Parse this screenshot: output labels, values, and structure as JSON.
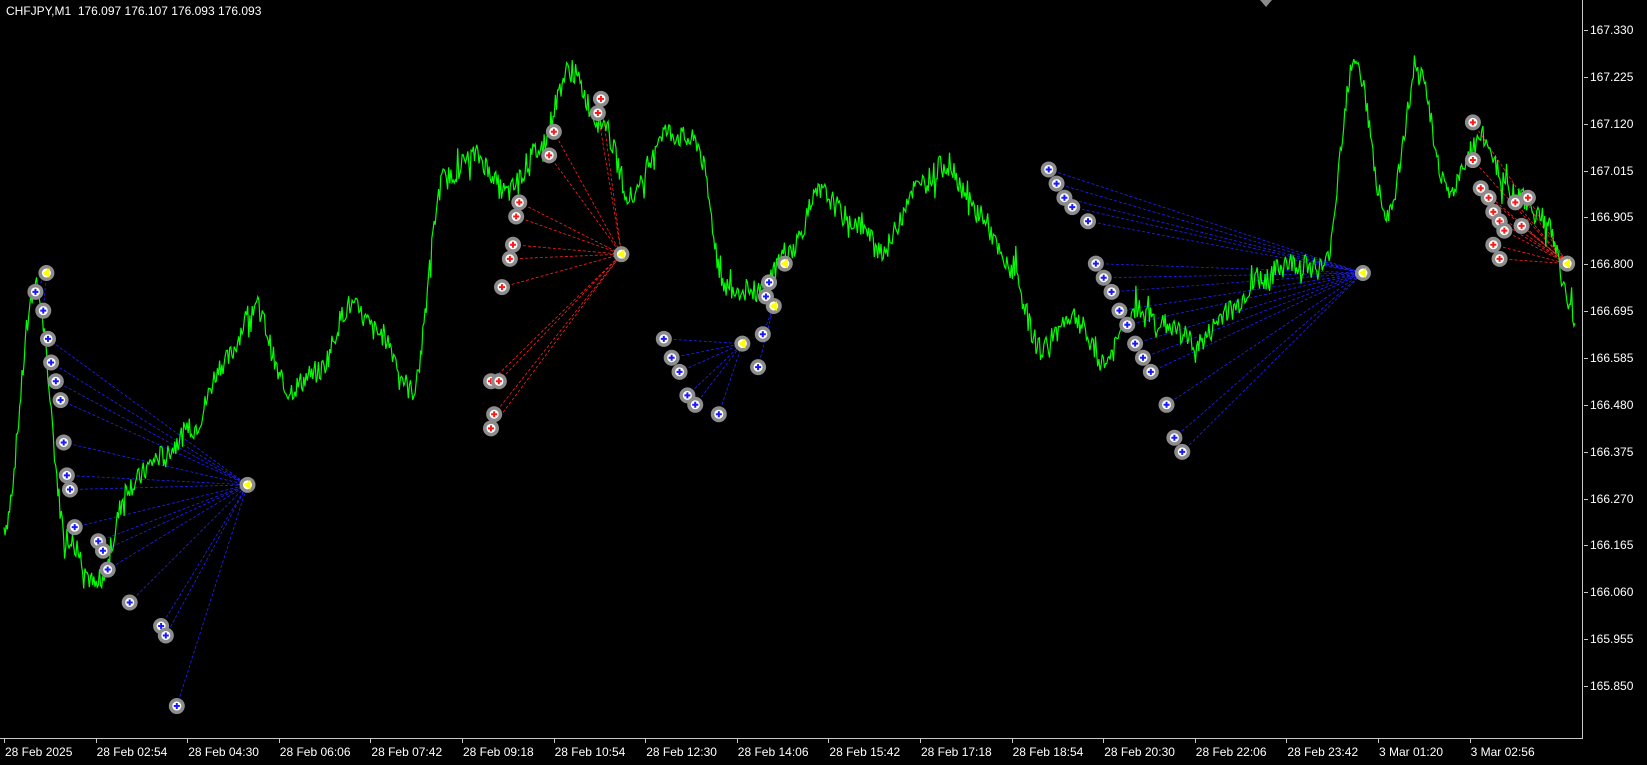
{
  "symbol": "CHFJPY,M1",
  "quote": {
    "open": "176.097",
    "high": "176.107",
    "low": "176.093",
    "close": "176.093"
  },
  "colors": {
    "background": "#000000",
    "price_line": "#00ff00",
    "buy_links": "#2020ff",
    "sell_links": "#ff2020",
    "marker_ring": "#8c8c8c",
    "marker_fill": "#ffffff",
    "close_marker": "#ffff00",
    "axis_text": "#ffffff"
  },
  "icons": {
    "buy_marker": "blue-plus-circle-icon",
    "sell_marker": "red-plus-circle-icon",
    "close_marker": "yellow-arrow-left-icon",
    "shift_marker": "triangle-down-icon"
  },
  "price_axis": {
    "labels": [
      "167.330",
      "167.225",
      "167.120",
      "167.015",
      "166.905",
      "166.800",
      "166.695",
      "166.585",
      "166.480",
      "166.375",
      "166.270",
      "166.165",
      "166.060",
      "165.955",
      "165.850"
    ]
  },
  "time_axis": {
    "labels": [
      "28 Feb 2025",
      "28 Feb 02:54",
      "28 Feb 04:30",
      "28 Feb 06:06",
      "28 Feb 07:42",
      "28 Feb 09:18",
      "28 Feb 10:54",
      "28 Feb 12:30",
      "28 Feb 14:06",
      "28 Feb 15:42",
      "28 Feb 17:18",
      "28 Feb 18:54",
      "28 Feb 20:30",
      "28 Feb 22:06",
      "28 Feb 23:42",
      "3 Mar 01:20",
      "3 Mar 02:56"
    ]
  },
  "chart_data": {
    "type": "line",
    "ylim": [
      165.82,
      167.39
    ],
    "x": [
      "28 Feb 2025",
      "28 Feb 02:54",
      "28 Feb 04:30",
      "28 Feb 06:06",
      "28 Feb 07:42",
      "28 Feb 09:18",
      "28 Feb 10:54",
      "28 Feb 12:30",
      "28 Feb 14:06",
      "28 Feb 15:42",
      "28 Feb 17:18",
      "28 Feb 18:54",
      "28 Feb 20:30",
      "28 Feb 22:06",
      "28 Feb 23:42",
      "3 Mar 01:20",
      "3 Mar 02:56"
    ],
    "series": [
      {
        "values": [
          166.27,
          166.78,
          166.25,
          166.14,
          166.36,
          166.42,
          166.48,
          166.62,
          166.74,
          166.56,
          166.6,
          166.74,
          166.68,
          166.56,
          167.01,
          167.06,
          166.98,
          167.07,
          167.24,
          167.13,
          166.97,
          167.11,
          167.09,
          166.78,
          166.77,
          166.86,
          166.98,
          166.92,
          166.86,
          166.99,
          167.04,
          166.94,
          166.82,
          166.65,
          166.72,
          166.62,
          166.73,
          166.7,
          166.66,
          166.73,
          166.8,
          166.83,
          166.82,
          167.27,
          166.92,
          167.23,
          166.98,
          167.1,
          166.98,
          166.93,
          166.72
        ]
      }
    ],
    "trades": {
      "buy_entries": [
        {
          "t": 0.02,
          "p": 166.77
        },
        {
          "t": 0.025,
          "p": 166.73
        },
        {
          "t": 0.028,
          "p": 166.67
        },
        {
          "t": 0.03,
          "p": 166.62
        },
        {
          "t": 0.033,
          "p": 166.58
        },
        {
          "t": 0.036,
          "p": 166.54
        },
        {
          "t": 0.038,
          "p": 166.45
        },
        {
          "t": 0.04,
          "p": 166.38
        },
        {
          "t": 0.042,
          "p": 166.35
        },
        {
          "t": 0.045,
          "p": 166.27
        },
        {
          "t": 0.06,
          "p": 166.24
        },
        {
          "t": 0.063,
          "p": 166.22
        },
        {
          "t": 0.066,
          "p": 166.18
        },
        {
          "t": 0.08,
          "p": 166.11
        },
        {
          "t": 0.1,
          "p": 166.06
        },
        {
          "t": 0.103,
          "p": 166.04
        },
        {
          "t": 0.11,
          "p": 165.89
        },
        {
          "t": 0.42,
          "p": 166.67
        },
        {
          "t": 0.425,
          "p": 166.63
        },
        {
          "t": 0.43,
          "p": 166.6
        },
        {
          "t": 0.435,
          "p": 166.55
        },
        {
          "t": 0.44,
          "p": 166.53
        },
        {
          "t": 0.455,
          "p": 166.51
        },
        {
          "t": 0.48,
          "p": 166.61
        },
        {
          "t": 0.483,
          "p": 166.68
        },
        {
          "t": 0.485,
          "p": 166.76
        },
        {
          "t": 0.487,
          "p": 166.79
        },
        {
          "t": 0.665,
          "p": 167.03
        },
        {
          "t": 0.67,
          "p": 167.0
        },
        {
          "t": 0.675,
          "p": 166.97
        },
        {
          "t": 0.68,
          "p": 166.95
        },
        {
          "t": 0.69,
          "p": 166.92
        },
        {
          "t": 0.695,
          "p": 166.83
        },
        {
          "t": 0.7,
          "p": 166.8
        },
        {
          "t": 0.705,
          "p": 166.77
        },
        {
          "t": 0.71,
          "p": 166.73
        },
        {
          "t": 0.715,
          "p": 166.7
        },
        {
          "t": 0.72,
          "p": 166.66
        },
        {
          "t": 0.725,
          "p": 166.63
        },
        {
          "t": 0.73,
          "p": 166.6
        },
        {
          "t": 0.74,
          "p": 166.53
        },
        {
          "t": 0.745,
          "p": 166.46
        },
        {
          "t": 0.75,
          "p": 166.43
        }
      ],
      "sell_entries": [
        {
          "t": 0.31,
          "p": 166.58
        },
        {
          "t": 0.315,
          "p": 166.58
        },
        {
          "t": 0.31,
          "p": 166.48
        },
        {
          "t": 0.312,
          "p": 166.51
        },
        {
          "t": 0.317,
          "p": 166.78
        },
        {
          "t": 0.322,
          "p": 166.84
        },
        {
          "t": 0.324,
          "p": 166.87
        },
        {
          "t": 0.326,
          "p": 166.93
        },
        {
          "t": 0.328,
          "p": 166.96
        },
        {
          "t": 0.347,
          "p": 167.06
        },
        {
          "t": 0.35,
          "p": 167.11
        },
        {
          "t": 0.378,
          "p": 167.15
        },
        {
          "t": 0.38,
          "p": 167.18
        },
        {
          "t": 0.935,
          "p": 167.13
        },
        {
          "t": 0.935,
          "p": 167.05
        },
        {
          "t": 0.94,
          "p": 166.99
        },
        {
          "t": 0.945,
          "p": 166.97
        },
        {
          "t": 0.948,
          "p": 166.94
        },
        {
          "t": 0.952,
          "p": 166.92
        },
        {
          "t": 0.955,
          "p": 166.9
        },
        {
          "t": 0.948,
          "p": 166.87
        },
        {
          "t": 0.952,
          "p": 166.84
        },
        {
          "t": 0.962,
          "p": 166.96
        },
        {
          "t": 0.966,
          "p": 166.91
        },
        {
          "t": 0.97,
          "p": 166.97
        }
      ],
      "close_points": [
        {
          "t": 0.027,
          "p": 166.81
        },
        {
          "t": 0.155,
          "p": 166.36
        },
        {
          "t": 0.393,
          "p": 166.85
        },
        {
          "t": 0.47,
          "p": 166.66
        },
        {
          "t": 0.49,
          "p": 166.74
        },
        {
          "t": 0.497,
          "p": 166.83
        },
        {
          "t": 0.865,
          "p": 166.81
        },
        {
          "t": 0.995,
          "p": 166.83
        }
      ]
    }
  }
}
